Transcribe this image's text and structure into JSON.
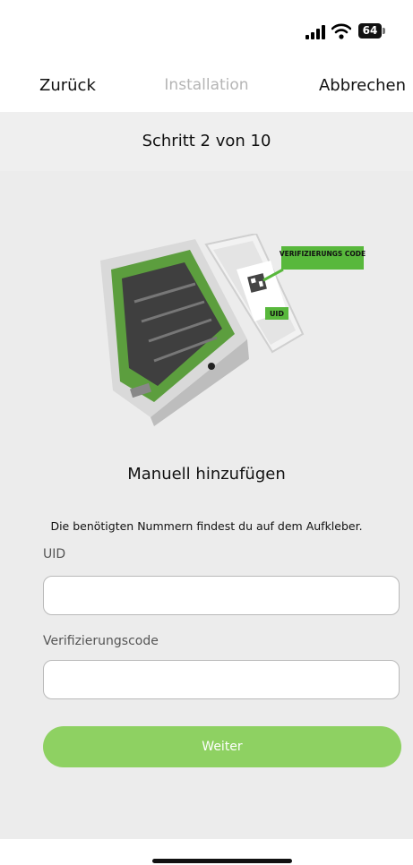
{
  "status_bar": {
    "battery_level": "64",
    "icons": [
      "signal-icon",
      "wifi-icon",
      "battery-icon"
    ]
  },
  "nav": {
    "back_label": "Zurück",
    "title": "Installation",
    "cancel_label": "Abbrechen"
  },
  "step": {
    "label": "Schritt 2 von 10"
  },
  "illustration": {
    "code_label": "VERIFIZIERUNGS CODE",
    "uid_label": "UID"
  },
  "manual": {
    "title": "Manuell hinzufügen",
    "hint": "Die benötigten Nummern findest du auf dem Aufkleber.",
    "uid_label": "UID",
    "uid_value": "",
    "code_label": "Verifizierungscode",
    "code_value": "",
    "submit_label": "Weiter"
  },
  "colors": {
    "accent": "#8ed162",
    "sticker_green": "#58b83c",
    "page_bg": "#ececec"
  }
}
